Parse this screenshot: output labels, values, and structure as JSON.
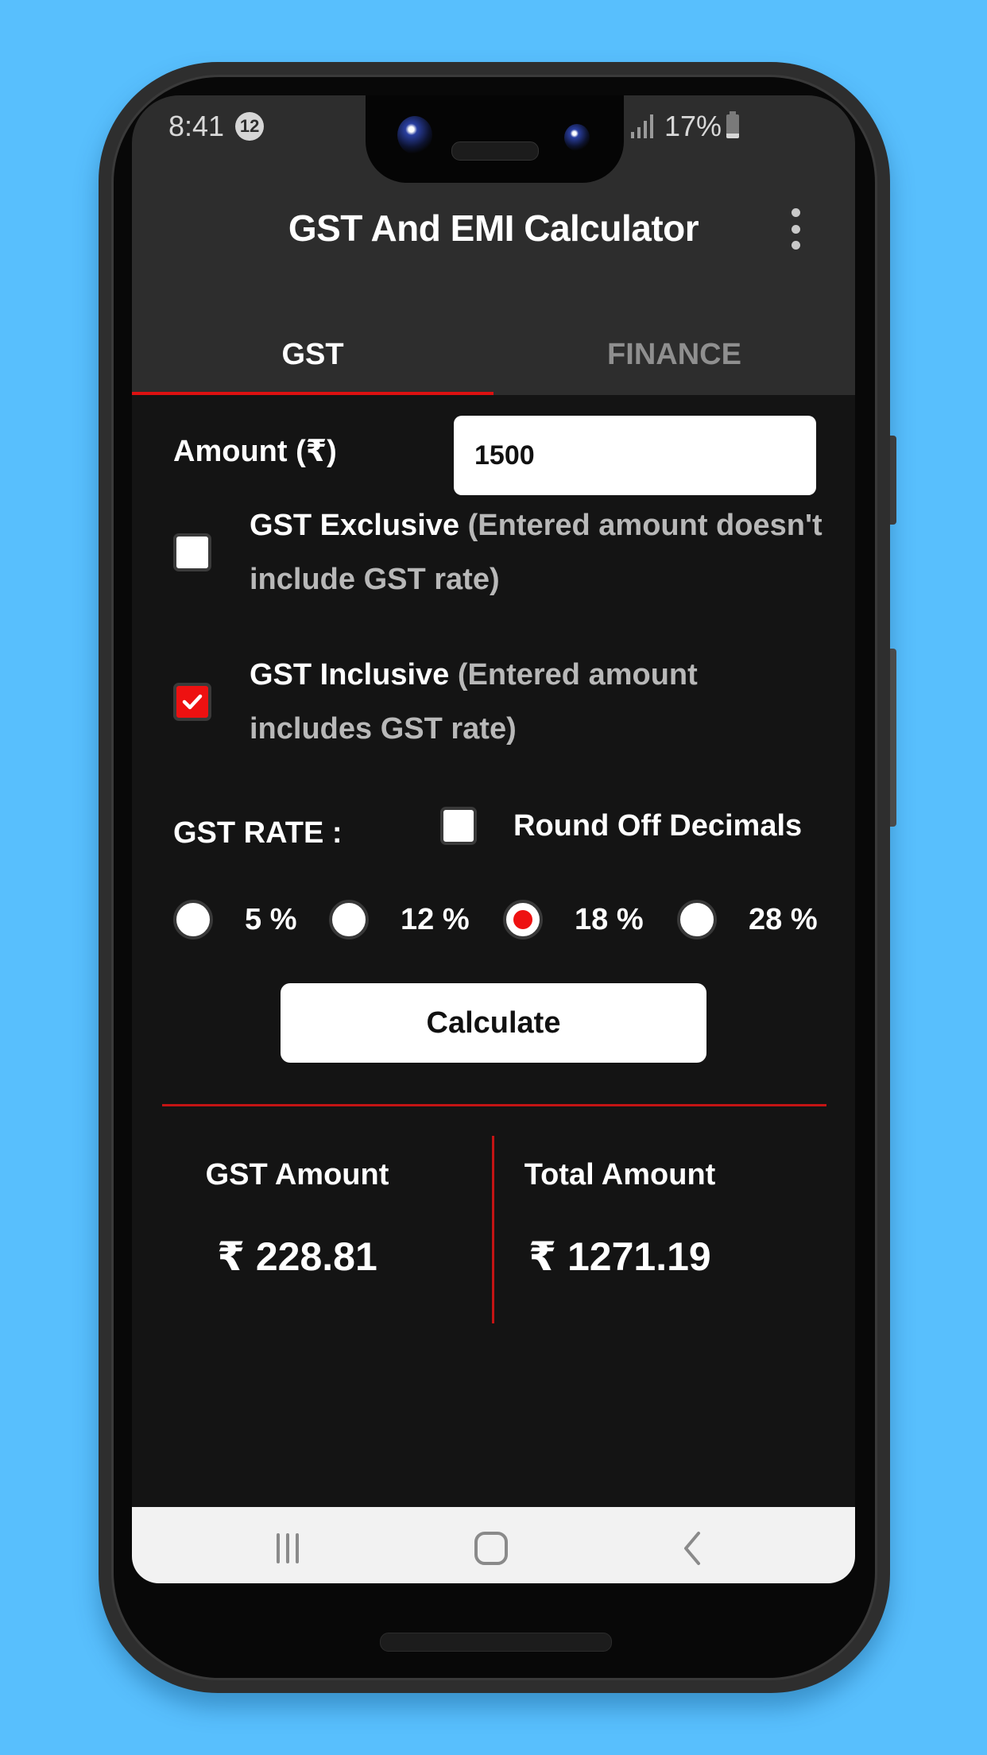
{
  "status_bar": {
    "time": "8:41",
    "notification_count": "12",
    "battery_percent": "17%",
    "icons": [
      "signal-icon",
      "battery-icon"
    ]
  },
  "app_bar": {
    "title": "GST And EMI Calculator",
    "menu_icon": "more-vert-icon"
  },
  "tabs": [
    {
      "label": "GST",
      "active": true
    },
    {
      "label": "FINANCE",
      "active": false
    }
  ],
  "form": {
    "amount_label": "Amount (₹)",
    "amount_value": "1500",
    "gst_exclusive": {
      "title": "GST Exclusive",
      "description": "(Entered amount doesn't include GST rate)",
      "checked": false
    },
    "gst_inclusive": {
      "title": "GST Inclusive",
      "description": "(Entered amount includes GST rate)",
      "checked": true
    },
    "gst_rate_label": "GST RATE :",
    "round_off": {
      "label": "Round Off Decimals",
      "checked": false
    },
    "rates": [
      {
        "label": "5 %",
        "selected": false
      },
      {
        "label": "12 %",
        "selected": false
      },
      {
        "label": "18 %",
        "selected": true
      },
      {
        "label": "28 %",
        "selected": false
      }
    ],
    "calculate_label": "Calculate"
  },
  "results": {
    "gst_amount_label": "GST Amount",
    "gst_amount_value": "₹ 228.81",
    "total_amount_label": "Total Amount",
    "total_amount_value": "₹ 1271.19"
  },
  "nav_bar": {
    "buttons": [
      "recents-icon",
      "home-icon",
      "back-icon"
    ]
  },
  "colors": {
    "accent": "#ee1111",
    "divider": "#c41414",
    "app_bar_bg": "#2d2d2d",
    "content_bg": "#141414",
    "background": "#58bffd"
  }
}
